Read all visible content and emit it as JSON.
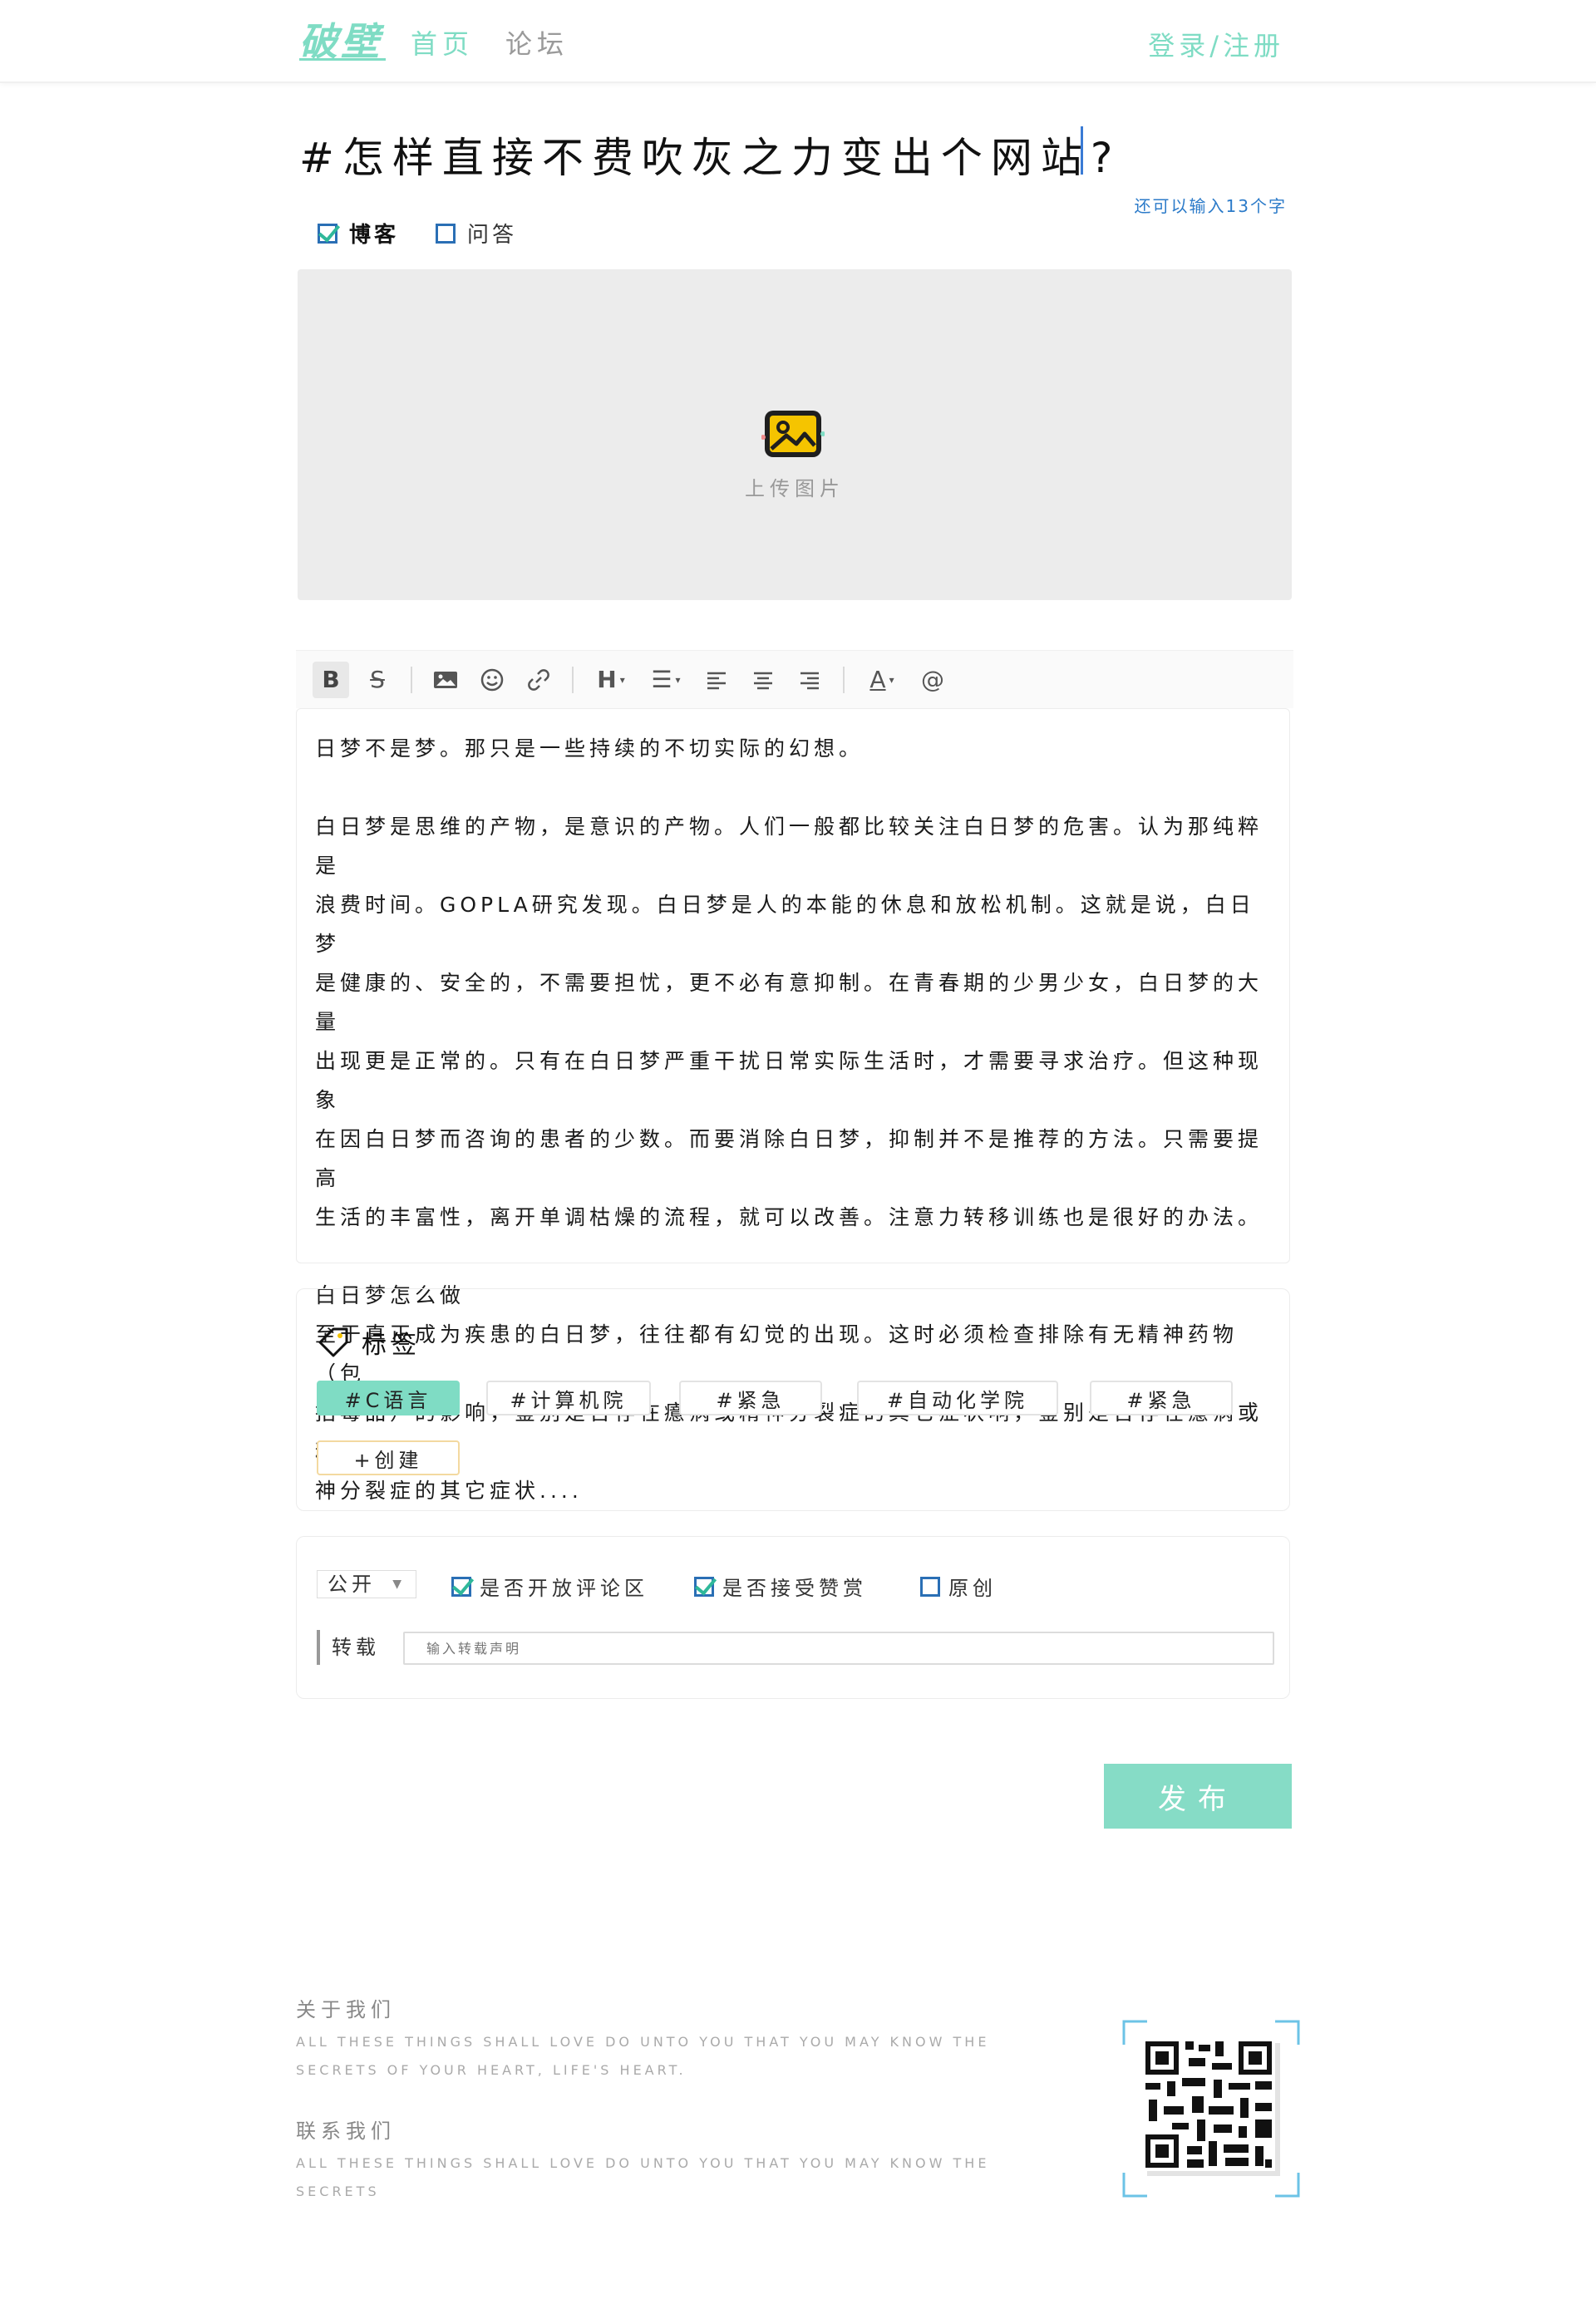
{
  "header": {
    "logo": "破壁",
    "nav": [
      "首页",
      "论坛"
    ],
    "login": "登录/注册"
  },
  "editor": {
    "title": "#怎样直接不费吹灰之力变出个网站?",
    "char_count": "还可以输入13个字",
    "types": [
      {
        "label": "博客",
        "checked": true
      },
      {
        "label": "问答",
        "checked": false
      }
    ],
    "upload_label": "上传图片",
    "toolbar_icons": [
      "bold-icon",
      "strikethrough-icon",
      "image-icon",
      "emoji-icon",
      "link-icon",
      "heading-icon",
      "list-icon",
      "align-left-icon",
      "align-center-icon",
      "align-right-icon",
      "font-color-icon",
      "mention-icon"
    ],
    "body": [
      "日梦不是梦。那只是一些持续的不切实际的幻想。",
      "",
      "白日梦是思维的产物，是意识的产物。人们一般都比较关注白日梦的危害。认为那纯粹是",
      "浪费时间。GOPLA研究发现。白日梦是人的本能的休息和放松机制。这就是说，白日梦",
      "是健康的、安全的，不需要担忧，更不必有意抑制。在青春期的少男少女，白日梦的大量",
      "出现更是正常的。只有在白日梦严重干扰日常实际生活时，才需要寻求治疗。但这种现象",
      "在因白日梦而咨询的患者的少数。而要消除白日梦，抑制并不是推荐的方法。只需要提高",
      "生活的丰富性，离开单调枯燥的流程，就可以改善。注意力转移训练也是很好的办法。",
      "",
      "白日梦怎么做",
      "至于真正成为疾患的白日梦，往往都有幻觉的出现。这时必须检查排除有无精神药物（包",
      "括毒品）的影响，鉴别是否存在癔病或精神分裂症的其它症状响，鉴别是否存在癔病或精",
      "神分裂症的其它症状...."
    ]
  },
  "tags": {
    "title": "标签",
    "items": [
      {
        "label": "#C语言",
        "selected": true
      },
      {
        "label": "#计算机院",
        "selected": false
      },
      {
        "label": "#紧急",
        "selected": false
      },
      {
        "label": "#自动化学院",
        "selected": false
      },
      {
        "label": "#紧急",
        "selected": false
      }
    ],
    "create": "+创建"
  },
  "options": {
    "visibility": "公开",
    "checks": [
      {
        "label": "是否开放评论区",
        "checked": true
      },
      {
        "label": "是否接受赞赏",
        "checked": true
      },
      {
        "label": "原创",
        "checked": false
      }
    ],
    "repost_label": "转载",
    "repost_placeholder": "输入转载声明"
  },
  "publish": "发布",
  "footer": {
    "about_title": "关于我们",
    "about_text": "ALL THESE THINGS SHALL LOVE DO UNTO YOU THAT YOU MAY KNOW THE SECRETS OF YOUR HEART, LIFE'S HEART.",
    "contact_title": "联系我们",
    "contact_text": "ALL THESE THINGS SHALL LOVE DO UNTO YOU THAT YOU MAY KNOW THE SECRETS"
  },
  "colors": {
    "accent": "#7fdcc4",
    "link": "#2c7bc9"
  }
}
